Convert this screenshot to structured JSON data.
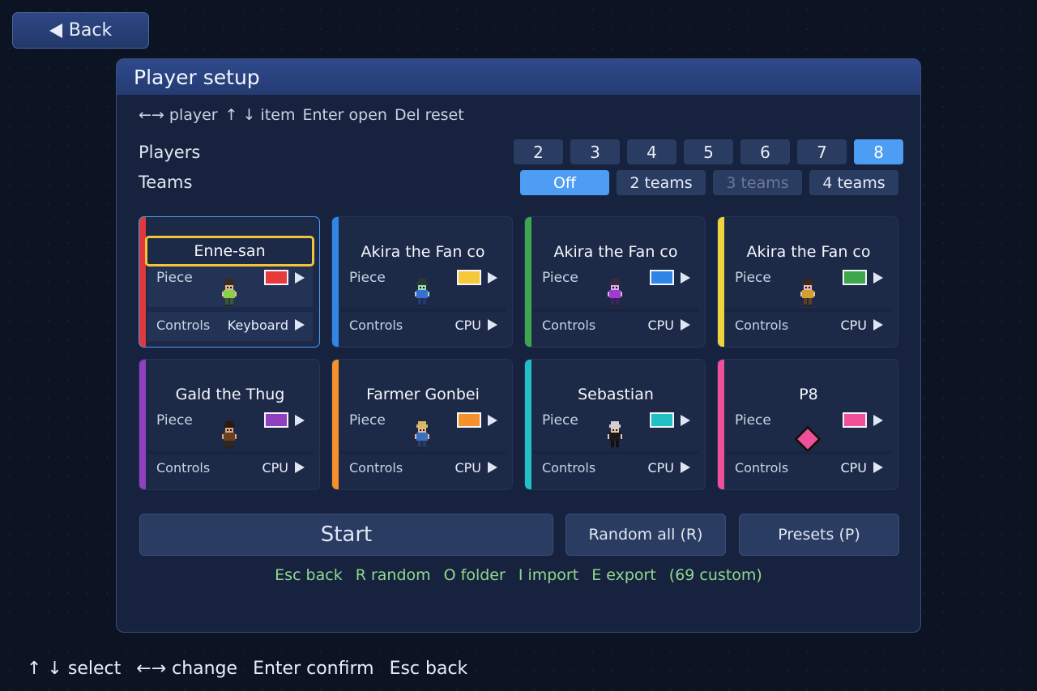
{
  "back_button": {
    "label": "Back"
  },
  "panel": {
    "title": "Player setup"
  },
  "top_hint": [
    "←→ player",
    "↑ ↓ item",
    "Enter open",
    "Del reset"
  ],
  "players": {
    "label": "Players",
    "options": [
      "2",
      "3",
      "4",
      "5",
      "6",
      "7",
      "8"
    ],
    "selected": "8"
  },
  "teams": {
    "label": "Teams",
    "options": [
      "Off",
      "2 teams",
      "3 teams",
      "4 teams"
    ],
    "selected": "Off",
    "disabled": [
      "3 teams"
    ]
  },
  "cards": [
    {
      "name": "Enne-san",
      "piece_label": "Piece",
      "color": "#e83a3a",
      "stripe": "#e0393b",
      "controls_label": "Controls",
      "controls": "Keyboard",
      "sprite": "hero-green"
    },
    {
      "name": "Akira the Fan co",
      "piece_label": "Piece",
      "color": "#f5c93a",
      "stripe": "#2f86e6",
      "controls_label": "Controls",
      "controls": "CPU",
      "sprite": "hero-blue"
    },
    {
      "name": "Akira the Fan co",
      "piece_label": "Piece",
      "color": "#2f86e6",
      "stripe": "#3da84b",
      "controls_label": "Controls",
      "controls": "CPU",
      "sprite": "hero-purple"
    },
    {
      "name": "Akira the Fan co",
      "piece_label": "Piece",
      "color": "#3da84b",
      "stripe": "#f0d23c",
      "controls_label": "Controls",
      "controls": "CPU",
      "sprite": "hero-yellow"
    },
    {
      "name": "Gald the Thug",
      "piece_label": "Piece",
      "color": "#8f3fc0",
      "stripe": "#8f3fc0",
      "controls_label": "Controls",
      "controls": "CPU",
      "sprite": "thug"
    },
    {
      "name": "Farmer Gonbei",
      "piece_label": "Piece",
      "color": "#f5902a",
      "stripe": "#f5902a",
      "controls_label": "Controls",
      "controls": "CPU",
      "sprite": "farmer"
    },
    {
      "name": "Sebastian",
      "piece_label": "Piece",
      "color": "#22c0c4",
      "stripe": "#22c0c4",
      "controls_label": "Controls",
      "controls": "CPU",
      "sprite": "butler"
    },
    {
      "name": "P8",
      "piece_label": "Piece",
      "color": "#f0509a",
      "stripe": "#f0509a",
      "controls_label": "Controls",
      "controls": "CPU",
      "sprite": "diamond"
    }
  ],
  "actions": {
    "start": "Start",
    "random_all": "Random all (R)",
    "presets": "Presets (P)"
  },
  "green_hint": [
    "Esc back",
    "R random",
    "O folder",
    "I import",
    "E export",
    "(69 custom)"
  ],
  "bottom_hint": [
    "↑ ↓ select",
    "←→ change",
    "Enter confirm",
    "Esc back"
  ]
}
